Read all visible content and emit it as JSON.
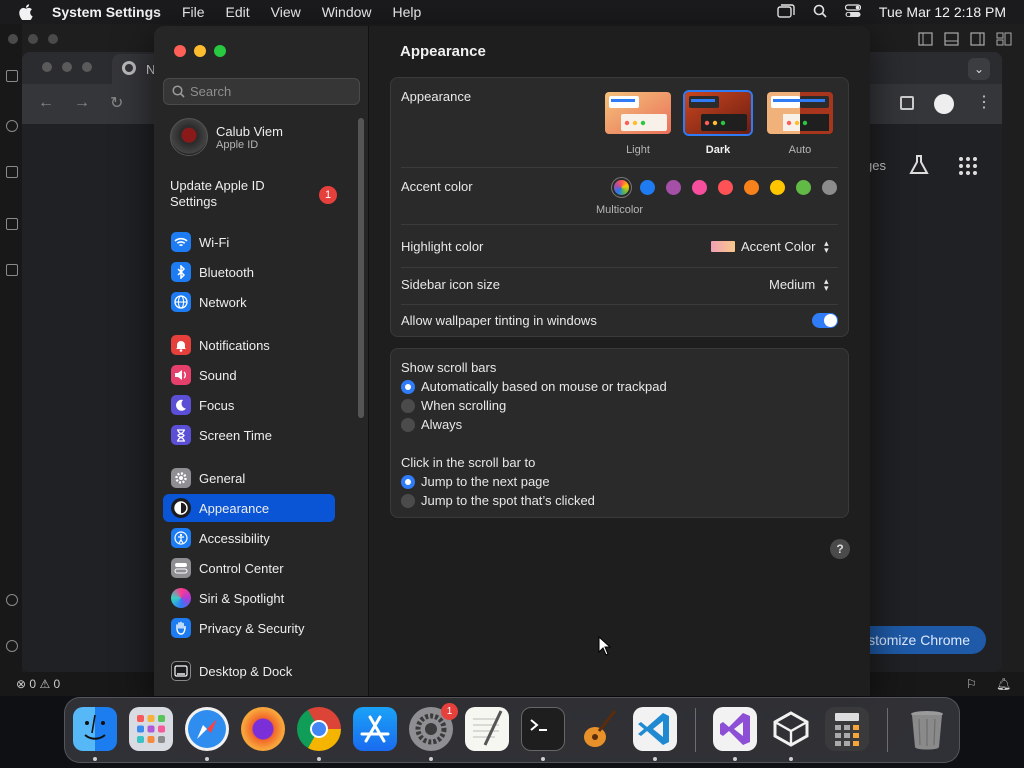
{
  "menubar": {
    "app_name": "System Settings",
    "items": [
      "File",
      "Edit",
      "View",
      "Window",
      "Help"
    ],
    "clock": "Tue Mar 12  2:18 PM"
  },
  "vscode": {
    "status_errors": "0",
    "status_warnings": "0"
  },
  "chrome": {
    "tab_title": "N",
    "customize_label": "ustomize Chrome",
    "partial_text": "ges"
  },
  "sidebar": {
    "search_placeholder": "Search",
    "profile_name": "Calub Viem",
    "profile_sub": "Apple ID",
    "update_label": "Update Apple ID Settings",
    "update_badge": "1",
    "items": [
      {
        "label": "Wi-Fi",
        "color": "#1e7cf2"
      },
      {
        "label": "Bluetooth",
        "color": "#1e7cf2"
      },
      {
        "label": "Network",
        "color": "#1e7cf2"
      },
      {
        "label": "Notifications",
        "color": "#e5403b"
      },
      {
        "label": "Sound",
        "color": "#e5406b"
      },
      {
        "label": "Focus",
        "color": "#5b4fd6"
      },
      {
        "label": "Screen Time",
        "color": "#5b4fd6"
      },
      {
        "label": "General",
        "color": "#8e8e93"
      },
      {
        "label": "Appearance",
        "color": "#1c1c1e"
      },
      {
        "label": "Accessibility",
        "color": "#1e7cf2"
      },
      {
        "label": "Control Center",
        "color": "#8e8e93"
      },
      {
        "label": "Siri & Spotlight",
        "color": "#b03ad8"
      },
      {
        "label": "Privacy & Security",
        "color": "#1e7cf2"
      },
      {
        "label": "Desktop & Dock",
        "color": "#1c1c1e"
      }
    ]
  },
  "content": {
    "title": "Appearance",
    "appearance_label": "Appearance",
    "modes": [
      "Light",
      "Dark",
      "Auto"
    ],
    "selected_mode": "Dark",
    "accent_label": "Accent color",
    "accent_selected_label": "Multicolor",
    "accent_colors": [
      "#1f7bf2",
      "#a550a7",
      "#f74f9e",
      "#ff5257",
      "#f7821b",
      "#ffc600",
      "#62ba46",
      "#8c8c8c"
    ],
    "highlight_label": "Highlight color",
    "highlight_value": "Accent Color",
    "sidebar_icon_label": "Sidebar icon size",
    "sidebar_icon_value": "Medium",
    "tinting_label": "Allow wallpaper tinting in windows",
    "scroll_title": "Show scroll bars",
    "scroll_options": [
      "Automatically based on mouse or trackpad",
      "When scrolling",
      "Always"
    ],
    "click_title": "Click in the scroll bar to",
    "click_options": [
      "Jump to the next page",
      "Jump to the spot that’s clicked"
    ],
    "help": "?"
  }
}
